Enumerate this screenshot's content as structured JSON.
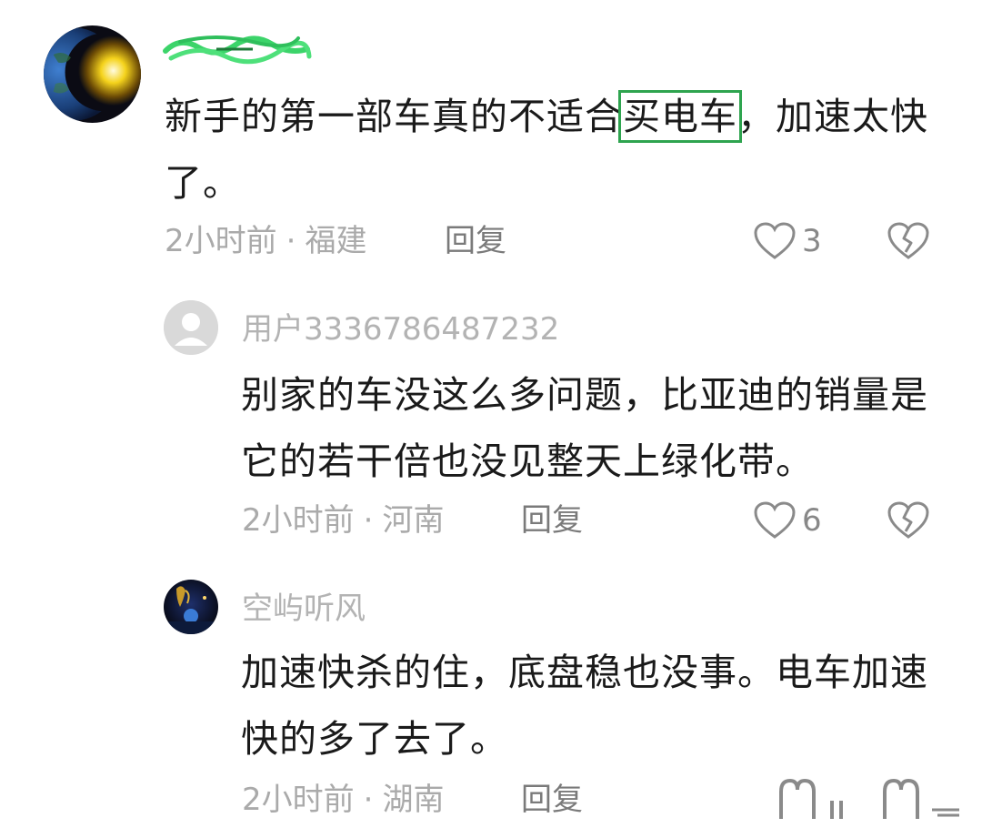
{
  "comments": [
    {
      "avatar_icon": "earth-space-avatar-icon",
      "text_before": "新手的第一部车真的不适合",
      "text_highlight": "买电车",
      "text_after": "，加速太快了。",
      "time": "2小时前",
      "region": "福建",
      "reply_label": "回复",
      "likes": "3"
    },
    {
      "avatar_icon": "default-user-avatar-icon",
      "username": "用户3336786487232",
      "text": "别家的车没这么多问题，比亚迪的销量是它的若干倍也没见整天上绿化带。",
      "time": "2小时前",
      "region": "河南",
      "reply_label": "回复",
      "likes": "6"
    },
    {
      "avatar_icon": "night-scene-avatar-icon",
      "username": "空屿听风",
      "text": "加速快杀的住，底盘稳也没事。电车加速快的多了去了。",
      "time": "2小时前",
      "region": "湖南",
      "reply_label": "回复"
    }
  ],
  "separator": "·",
  "colors": {
    "highlight_box": "#2ea44f",
    "redaction": "#3cd46a"
  }
}
